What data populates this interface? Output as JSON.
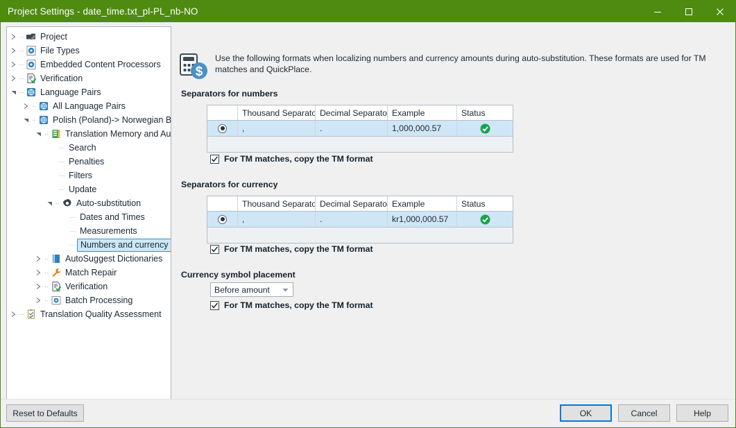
{
  "window": {
    "title": "Project Settings - date_time.txt_pl-PL_nb-NO",
    "titlebar_color": "#4e8b10",
    "controls": {
      "minimize": "minimize-icon",
      "maximize": "maximize-icon",
      "close": "close-icon"
    }
  },
  "tree": {
    "items": [
      {
        "label": "Project",
        "icon": "project-icon",
        "arrow": "collapsed",
        "depth": 0,
        "selected": false
      },
      {
        "label": "File Types",
        "icon": "filetypes-icon",
        "arrow": "collapsed",
        "depth": 0,
        "selected": false
      },
      {
        "label": "Embedded Content Processors",
        "icon": "embedded-icon",
        "arrow": "collapsed",
        "depth": 0,
        "selected": false
      },
      {
        "label": "Verification",
        "icon": "verification-icon",
        "arrow": "collapsed",
        "depth": 0,
        "selected": false
      },
      {
        "label": "Language Pairs",
        "icon": "globe-icon",
        "arrow": "expanded",
        "depth": 0,
        "selected": false
      },
      {
        "label": "All Language Pairs",
        "icon": "globe-icon",
        "arrow": "collapsed",
        "depth": 1,
        "selected": false
      },
      {
        "label": "Polish (Poland)-> Norwegian Bokmål",
        "icon": "globe-icon",
        "arrow": "expanded",
        "depth": 1,
        "selected": false
      },
      {
        "label": "Translation Memory and Autom",
        "icon": "tm-icon",
        "arrow": "expanded",
        "depth": 2,
        "selected": false
      },
      {
        "label": "Search",
        "icon": "none",
        "arrow": "none",
        "depth": 3,
        "selected": false
      },
      {
        "label": "Penalties",
        "icon": "none",
        "arrow": "none",
        "depth": 3,
        "selected": false
      },
      {
        "label": "Filters",
        "icon": "none",
        "arrow": "none",
        "depth": 3,
        "selected": false
      },
      {
        "label": "Update",
        "icon": "none",
        "arrow": "none",
        "depth": 3,
        "selected": false
      },
      {
        "label": "Auto-substitution",
        "icon": "gear-icon",
        "arrow": "expanded",
        "depth": 3,
        "selected": false
      },
      {
        "label": "Dates and Times",
        "icon": "none",
        "arrow": "none",
        "depth": 4,
        "selected": false
      },
      {
        "label": "Measurements",
        "icon": "none",
        "arrow": "none",
        "depth": 4,
        "selected": false
      },
      {
        "label": "Numbers and currency",
        "icon": "none",
        "arrow": "none",
        "depth": 4,
        "selected": true
      },
      {
        "label": "AutoSuggest Dictionaries",
        "icon": "book-icon",
        "arrow": "collapsed",
        "depth": 2,
        "selected": false
      },
      {
        "label": "Match Repair",
        "icon": "wrench-icon",
        "arrow": "collapsed",
        "depth": 2,
        "selected": false
      },
      {
        "label": "Verification",
        "icon": "verification-icon",
        "arrow": "collapsed",
        "depth": 2,
        "selected": false
      },
      {
        "label": "Batch Processing",
        "icon": "batch-icon",
        "arrow": "collapsed",
        "depth": 2,
        "selected": false
      },
      {
        "label": "Translation Quality Assessment",
        "icon": "tqa-icon",
        "arrow": "collapsed",
        "depth": 0,
        "selected": false
      }
    ]
  },
  "main": {
    "header_icon": "calculator-currency-icon",
    "header_text": "Use the following formats when localizing numbers and currency amounts during auto-substitution. These formats are used for TM matches and QuickPlace.",
    "numbers_section": {
      "label": "Separators for numbers",
      "columns": [
        "",
        "Thousand Separator",
        "Decimal Separator",
        "Example",
        "Status"
      ],
      "rows": [
        {
          "selected": true,
          "thousand_separator": ",",
          "decimal_separator": ".",
          "example": "1,000,000.57",
          "status": "valid-check-icon"
        }
      ],
      "checkbox_label": "For TM matches, copy the TM format",
      "checkbox_checked": true
    },
    "currency_section": {
      "label": "Separators for currency",
      "columns": [
        "",
        "Thousand Separator",
        "Decimal Separator",
        "Example",
        "Status"
      ],
      "rows": [
        {
          "selected": true,
          "thousand_separator": ",",
          "decimal_separator": ".",
          "example": "kr1,000,000.57",
          "status": "valid-check-icon"
        }
      ],
      "checkbox_label": "For TM matches, copy the TM format",
      "checkbox_checked": true
    },
    "placement_section": {
      "label": "Currency symbol placement",
      "dropdown_value": "Before amount",
      "checkbox_label": "For TM matches, copy the TM format",
      "checkbox_checked": true
    }
  },
  "footer": {
    "reset_label": "Reset to Defaults",
    "ok_label": "OK",
    "cancel_label": "Cancel",
    "help_label": "Help"
  },
  "colors": {
    "accent_green": "#4e8b10",
    "selection_blue": "#cfe6f7",
    "focus_blue": "#0078d7",
    "status_green": "#16a34a"
  }
}
